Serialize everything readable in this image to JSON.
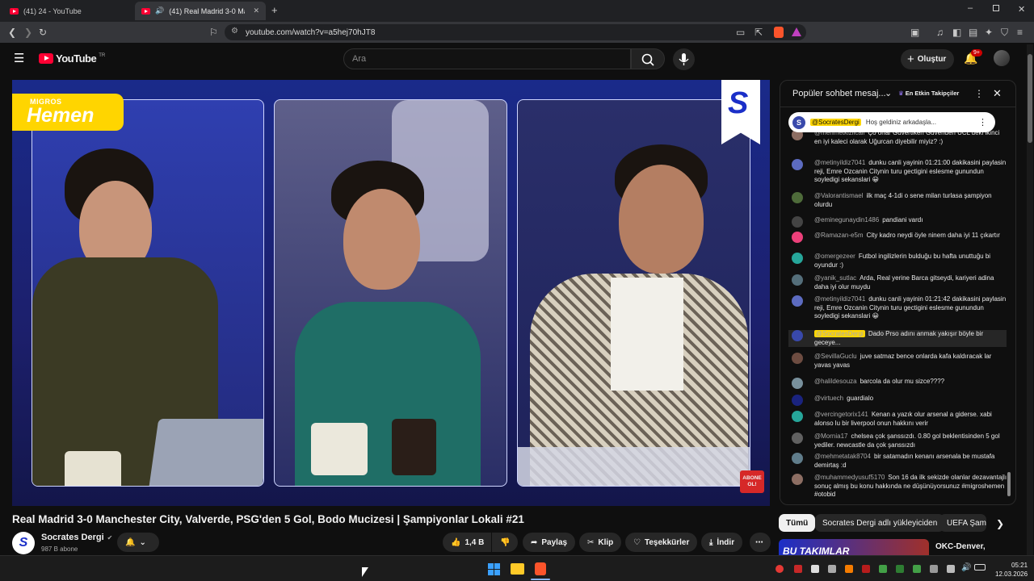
{
  "browser": {
    "tabs": [
      {
        "label": "(41) 24 - YouTube"
      },
      {
        "label": "(41) Real Madrid 3-0 Manchester"
      }
    ],
    "url": "youtube.com/watch?v=a5hej70hJT8"
  },
  "youtube": {
    "logo": "YouTube",
    "region": "TR",
    "search_placeholder": "Ara",
    "create_label": "Oluştur",
    "notif_count": "9+"
  },
  "video": {
    "sponsor_top": "MIGROS",
    "sponsor_main": "Hemen",
    "channel_badge": "S",
    "subscribe_tag": "ABONE OL!",
    "cup_logo": "S"
  },
  "chat": {
    "header_title": "Popüler sohbet mesaj...",
    "header_badge": "En Etkin Takipçiler",
    "pinned": {
      "author": "@SocratesDergi",
      "text": "Hoş geldiniz arkadaşla..."
    },
    "messages": [
      {
        "author": "@mehmetkizilcali",
        "text": "Ço orlar Güvertiken Guvenden UCL'deki ikinci en iyi kaleci olarak Uğurcan diyebilir miyiz? :)",
        "color": "#8d6e63"
      },
      {
        "author": "@metinyildiz7041",
        "text": "dunku canli yayinin 01:21:00 dakikasini paylasin reji, Emre Ozcanin Citynin turu gectigini eslesme gunundun soyledigi sekanslari 😀",
        "color": "#5c6bc0"
      },
      {
        "author": "@Valorantismael",
        "text": "ilk maç 4-1di o sene milan turlasa şampiyon olurdu",
        "color": "#4e6b3a"
      },
      {
        "author": "@eminegunaydin1486",
        "text": "pandiani vardı",
        "color": "#444444"
      },
      {
        "author": "@Ramazan-e5m",
        "text": "City kadro neydi öyle ninem daha iyi 11 çıkartır",
        "color": "#ec407a"
      },
      {
        "author": "@omergezeer",
        "text": "Futbol ingilizlerin bulduğu bu hafta unuttuğu bi oyundur :)",
        "color": "#26a69a"
      },
      {
        "author": "@yanik_sutlac",
        "text": "Arda, Real yerine Barca gitseydi, kariyeri adina daha iyi olur muydu",
        "color": "#546e7a"
      },
      {
        "author": "@metinyildiz7041",
        "text": "dunku canli yayinin 01:21:42 dakikasini paylasin reji, Emre Ozcanin Citynin turu gectigini eslesme gunundun soyledigi sekanslari 😀",
        "color": "#5c6bc0"
      },
      {
        "author": "@SocratesDergi",
        "text": "Dado Prso adını anmak yakışır böyle bir geceye...",
        "color": "#3949ab",
        "owner": true
      },
      {
        "author": "@SevillaGuclu",
        "text": "juve satmaz bence onlarda kafa kaldıracak lar yavas yavas",
        "color": "#6d4c41"
      },
      {
        "author": "@halildesouza",
        "text": "barcola da olur mu sizce????",
        "color": "#78909c"
      },
      {
        "author": "@virtuech",
        "text": "guardialo",
        "color": "#1a237e"
      },
      {
        "author": "@vercingetorix141",
        "text": "Kenan a yazık olur arsenal a giderse. xabi alonso lu bir liverpool onun hakkını verir",
        "color": "#26a69a"
      },
      {
        "author": "@Mornia17",
        "text": "chelsea çok şanssızdı. 0.80 gol beklentisinden 5 gol yediler. newcastle da çok şanssızdı",
        "color": "#616161"
      },
      {
        "author": "@mehmetatak8704",
        "text": "bir satamadın kenanı arsenala be mustafa demirtaş :d",
        "color": "#607d8b"
      },
      {
        "author": "@muhammedyusuf5170",
        "text": "Son 16 da ilk sekizde olanlar dezavantajlı sonuç almış bu konu hakkında ne düşünüyorsunuz #migroshemen #otobid",
        "color": "#8d6e63"
      }
    ]
  },
  "below": {
    "title": "Real Madrid 3-0 Manchester City, Valverde, PSG'den 5 Gol, Bodo Mucizesi | Şampiyonlar Lokali #21",
    "channel_name": "Socrates Dergi",
    "subscribers": "987 B abone",
    "likes": "1,4 B",
    "share": "Paylaş",
    "clip": "Klip",
    "thanks": "Teşekkürler",
    "download": "İndir"
  },
  "chips": {
    "all": "Tümü",
    "uploader": "Socrates Dergi adlı yükleyiciden",
    "third": "UEFA Şamp"
  },
  "suggest": {
    "thumb_text": "BU TAKIMLAR",
    "title": "OKC-Denver,"
  },
  "taskbar": {
    "time": "05:21",
    "date": "12.03.2026"
  }
}
